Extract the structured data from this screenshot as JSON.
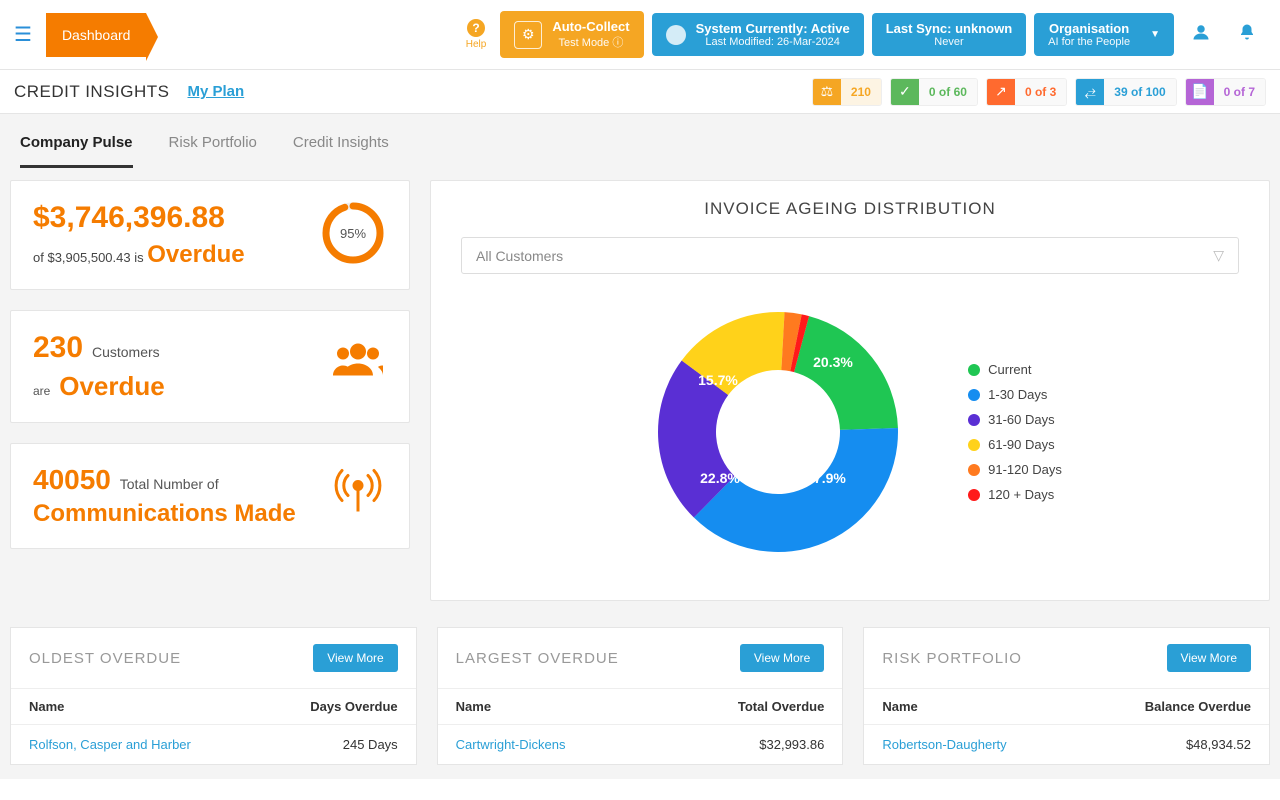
{
  "topbar": {
    "dashboard": "Dashboard",
    "help": "Help",
    "auto_collect": {
      "title": "Auto-Collect",
      "sub": "Test Mode"
    },
    "system": {
      "title": "System Currently: Active",
      "sub": "Last Modified: 26-Mar-2024"
    },
    "sync": {
      "title": "Last Sync: unknown",
      "sub": "Never"
    },
    "org": {
      "title": "Organisation",
      "sub": "AI for the People"
    }
  },
  "subbar": {
    "title": "CREDIT INSIGHTS",
    "myplan": "My Plan",
    "badges": [
      {
        "value": "210",
        "color": "o"
      },
      {
        "value": "0 of 60",
        "color": "g"
      },
      {
        "value": "0 of 3",
        "color": "r"
      },
      {
        "value": "39 of 100",
        "color": "b"
      },
      {
        "value": "0 of 7",
        "color": "p"
      }
    ]
  },
  "tabs": [
    "Company Pulse",
    "Risk Portfolio",
    "Credit Insights"
  ],
  "overdue_amount": {
    "amount": "$3,746,396.88",
    "of_label": "of",
    "total": "$3,905,500.43",
    "is_label": "is",
    "overdue": "Overdue",
    "pct": "95%"
  },
  "customers_overdue": {
    "count": "230",
    "label": "Customers",
    "are": "are",
    "overdue": "Overdue"
  },
  "communications": {
    "count": "40050",
    "label": "Total Number of",
    "row2": "Communications Made"
  },
  "chart": {
    "title": "INVOICE AGEING DISTRIBUTION",
    "dropdown": "All Customers",
    "legend": [
      "Current",
      "1-30 Days",
      "31-60 Days",
      "61-90 Days",
      "91-120 Days",
      "120 + Days"
    ]
  },
  "chart_data": {
    "type": "pie",
    "title": "INVOICE AGEING DISTRIBUTION",
    "series": [
      {
        "name": "Current",
        "value": 20.3,
        "color": "#1fc653"
      },
      {
        "name": "1-30 Days",
        "value": 37.9,
        "color": "#158df0"
      },
      {
        "name": "31-60 Days",
        "value": 22.8,
        "color": "#5a2fd4"
      },
      {
        "name": "61-90 Days",
        "value": 15.7,
        "color": "#ffd21a"
      },
      {
        "name": "91-120 Days",
        "value": 2.3,
        "color": "#ff7a1f"
      },
      {
        "name": "120 + Days",
        "value": 1.0,
        "color": "#ff1a1a"
      }
    ],
    "labels_shown": [
      "20.3%",
      "37.9%",
      "22.8%",
      "15.7%"
    ]
  },
  "oldest": {
    "title": "OLDEST OVERDUE",
    "view_more": "View  More",
    "col1": "Name",
    "col2": "Days Overdue",
    "rows": [
      {
        "name": "Rolfson, Casper and Harber",
        "value": "245 Days"
      }
    ]
  },
  "largest": {
    "title": "LARGEST OVERDUE",
    "view_more": "View  More",
    "col1": "Name",
    "col2": "Total Overdue",
    "rows": [
      {
        "name": "Cartwright-Dickens",
        "value": "$32,993.86"
      }
    ]
  },
  "risk": {
    "title": "RISK PORTFOLIO",
    "view_more": "View  More",
    "col1": "Name",
    "col2": "Balance Overdue",
    "rows": [
      {
        "name": "Robertson-Daugherty",
        "value": "$48,934.52"
      }
    ]
  }
}
